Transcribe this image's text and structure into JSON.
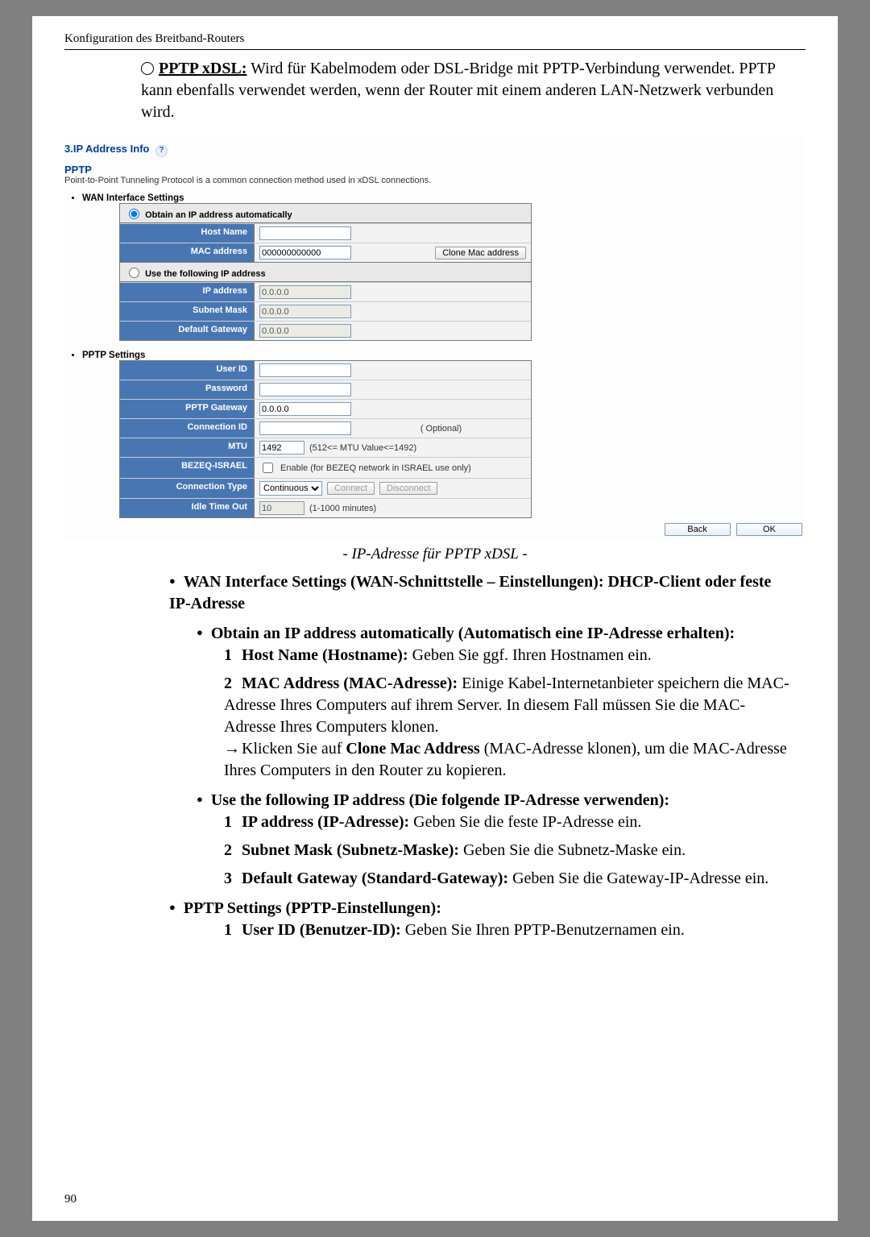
{
  "header": {
    "title": "Konfiguration des Breitband-Routers"
  },
  "intro": {
    "label": "PPTP xDSL:",
    "text1": " Wird für Kabelmodem oder DSL-Bridge mit PPTP-Verbindung verwendet. PPTP kann ebenfalls verwendet werden, wenn der Router mit einem anderen LAN-Netzwerk verbunden wird."
  },
  "shot": {
    "section_title_prefix": "3.IP Address Info ",
    "help": "?",
    "pptp_title": "PPTP",
    "pptp_desc": "Point-to-Point Tunneling Protocol is a common connection method used in xDSL connections.",
    "wan_heading": "WAN Interface Settings",
    "radio_auto": "Obtain an IP address automatically",
    "radio_static": "Use the following IP address",
    "host_name_label": "Host Name",
    "host_name_value": "",
    "mac_label": "MAC address",
    "mac_value": "000000000000",
    "clone_btn": "Clone Mac address",
    "ip_label": "IP address",
    "ip_value": "0.0.0.0",
    "subnet_label": "Subnet Mask",
    "subnet_value": "0.0.0.0",
    "gw_label": "Default Gateway",
    "gw_value": "0.0.0.0",
    "pptp_settings_heading": "PPTP Settings",
    "user_id_label": "User ID",
    "user_id_value": "",
    "password_label": "Password",
    "password_value": "",
    "pptp_gw_label": "PPTP Gateway",
    "pptp_gw_value": "0.0.0.0",
    "conn_id_label": "Connection ID",
    "conn_id_value": "",
    "conn_id_note": "( Optional)",
    "mtu_label": "MTU",
    "mtu_value": "1492",
    "mtu_note": "(512<= MTU Value<=1492)",
    "bezeq_label": "BEZEQ-ISRAEL",
    "bezeq_check": "Enable (for BEZEQ network in ISRAEL use only)",
    "conn_type_label": "Connection Type",
    "conn_type_value": "Continuous",
    "connect_btn": "Connect",
    "disconnect_btn": "Disconnect",
    "idle_label": "Idle Time Out",
    "idle_value": "10",
    "idle_note": "(1-1000 minutes)",
    "back_btn": "Back",
    "ok_btn": "OK"
  },
  "caption": "- IP-Adresse für PPTP xDSL -",
  "doc": {
    "l1": "WAN Interface Settings (WAN-Schnittstelle – Einstellungen): DHCP-Client oder feste IP-Adresse",
    "l2": "Obtain an IP address automatically (Automatisch eine IP-Adresse erhalten):",
    "l2_1b": "Host Name (Hostname):",
    "l2_1t": " Geben Sie ggf. Ihren Hostnamen ein.",
    "l2_2b": "MAC Address (MAC-Adresse):",
    "l2_2t": " Einige Kabel-Internetanbieter speichern die MAC-Adresse Ihres Computers auf ihrem Server. In diesem Fall müssen Sie die MAC-Adresse Ihres Computers klonen.",
    "l2_2arrow_pre": "Klicken Sie auf ",
    "l2_2arrow_bold": "Clone Mac Address",
    "l2_2arrow_post": " (MAC-Adresse klonen), um die MAC-Adresse Ihres Computers in den Router zu kopieren.",
    "l3": "Use the following IP address (Die folgende IP-Adresse verwenden):",
    "l3_1b": "IP address (IP-Adresse):",
    "l3_1t": " Geben Sie die feste IP-Adresse ein.",
    "l3_2b": "Subnet Mask (Subnetz-Maske):",
    "l3_2t": " Geben Sie die Subnetz-Maske ein.",
    "l3_3b": "Default Gateway (Standard-Gateway):",
    "l3_3t": " Geben Sie die Gateway-IP-Adresse ein.",
    "l4": "PPTP Settings (PPTP-Einstellungen):",
    "l4_1b": "User ID (Benutzer-ID):",
    "l4_1t": " Geben Sie Ihren PPTP-Benutzernamen ein."
  },
  "pagenum": "90"
}
